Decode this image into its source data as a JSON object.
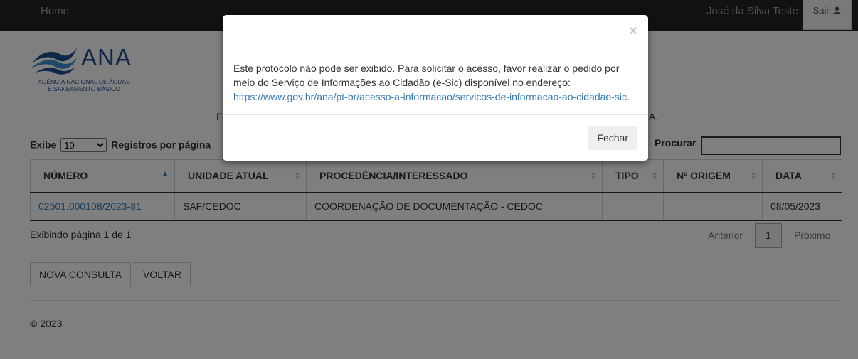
{
  "nav": {
    "home": "Home",
    "user": "José da Silva Teste",
    "logout": "Sair"
  },
  "logo": {
    "name": "ANA",
    "sub_line1": "AGÊNCIA NACIONAL DE ÁGUAS",
    "sub_line2": "E SANEAMENTO BÁSICO"
  },
  "partial_text": {
    "start": "F",
    "end": "A."
  },
  "length": {
    "prefix": "Exibe",
    "value": "10",
    "suffix": "Registros por página"
  },
  "search": {
    "label": "Procurar",
    "value": ""
  },
  "table": {
    "headers": [
      "NÚMERO",
      "UNIDADE ATUAL",
      "PROCEDÊNCIA/INTERESSADO",
      "TIPO",
      "Nº ORIGEM",
      "DATA"
    ],
    "rows": [
      {
        "numero": "02501.000108/2023-81",
        "unidade": "SAF/CEDOC",
        "procedencia": "COORDENAÇÃO DE DOCUMENTAÇÃO - CEDOC",
        "tipo": "",
        "origem": "",
        "data": "08/05/2023"
      }
    ]
  },
  "info": "Exibindo página 1 de 1",
  "pager": {
    "prev": "Anterior",
    "page": "1",
    "next": "Próximo"
  },
  "buttons": {
    "new_query": "NOVA CONSULTA",
    "back": "VOLTAR"
  },
  "footer": {
    "copyright": "© 2023"
  },
  "modal": {
    "close": "×",
    "message": "Este protocolo não pode ser exibido. Para solicitar o acesso, favor realizar o pedido por meio do Serviço de Informações ao Cidadão (e-Sic) disponível no endereço:",
    "link": "https://www.gov.br/ana/pt-br/acesso-a-informacao/servicos-de-informacao-ao-cidadao-sic",
    "link_suffix": ".",
    "button": "Fechar"
  }
}
